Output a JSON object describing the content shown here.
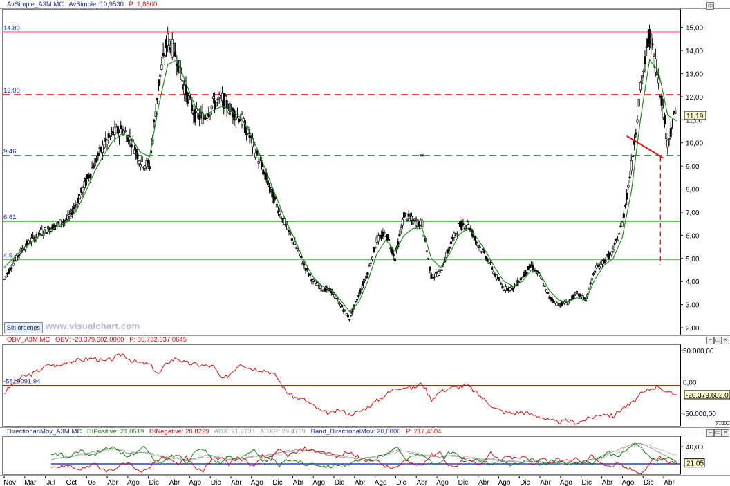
{
  "panels": {
    "price": {
      "legend": [
        {
          "text": "AvSimple_A3M.MC",
          "color": "#1a2faf"
        },
        {
          "text": "AvSimple: 10,9530",
          "color": "#1a2faf"
        },
        {
          "text": "P: 1,8800",
          "color": "#d01010"
        }
      ],
      "badge": "Sin órdenes",
      "watermark": "www.visualchart.com"
    },
    "obv": {
      "legend": [
        {
          "text": "OBV_A3M.MC",
          "color": "#d01010"
        },
        {
          "text": "OBV: -20.379.602,0000",
          "color": "#d01010"
        },
        {
          "text": "P: 85.732.637,0645",
          "color": "#d01010"
        }
      ],
      "scale_box": "x1000"
    },
    "dm": {
      "legend": [
        {
          "text": "DirectionanMov_A3M.MC",
          "color": "#1a2a7a"
        },
        {
          "text": "DIPositive: 21,0519",
          "color": "#178017"
        },
        {
          "text": "DINegative: 20,8229",
          "color": "#d01010"
        },
        {
          "text": "ADX: 21,2738",
          "color": "#9a9a9a"
        },
        {
          "text": "ADXR: 29,4739",
          "color": "#9a9a9a"
        },
        {
          "text": "Band_DirectionalMov: 20,0000",
          "color": "#1a2faf"
        },
        {
          "text": "P: 217,4604",
          "color": "#d01010"
        }
      ]
    }
  },
  "chart_data": [
    {
      "type": "line",
      "title": "",
      "x_tick_labels": [
        "Nov",
        "Mar",
        "Jul",
        "Oct",
        "05",
        "Abr",
        "Ago",
        "Dic",
        "Abr",
        "Ago",
        "Dic",
        "Abr",
        "Ago",
        "Dic",
        "Abr",
        "Ago",
        "Dic",
        "Abr",
        "Ago",
        "Dic",
        "Abr",
        "Ago",
        "Dic",
        "Abr",
        "Ago",
        "Dic",
        "Abr",
        "Ago",
        "Dic",
        "Abr",
        "Ago",
        "Dic",
        "Abr"
      ],
      "y_tick_labels": [
        "15,00",
        "14,00",
        "13,00",
        "12,00",
        "11,00",
        "10,00",
        "9,00",
        "8,00",
        "7,00",
        "6,00",
        "5,00",
        "4,00",
        "3,00",
        "2,00"
      ],
      "ylim": [
        1.7,
        15.8
      ],
      "last_value_label": "11,19",
      "last_value": 11.19,
      "series": [
        {
          "name": "",
          "style": "candles",
          "color": "#000000",
          "values": [
            4.1,
            4.8,
            5.4,
            5.8,
            6.1,
            6.3,
            6.5,
            6.7,
            7.4,
            8.3,
            9.2,
            9.9,
            10.4,
            10.6,
            10.1,
            9.2,
            9.0,
            12.6,
            14.5,
            13.7,
            12.2,
            11.2,
            11.1,
            11.7,
            11.9,
            11.4,
            11.1,
            10.3,
            9.3,
            8.3,
            7.3,
            6.4,
            5.6,
            4.7,
            4.0,
            3.7,
            3.6,
            3.0,
            2.4,
            3.4,
            4.4,
            5.8,
            6.1,
            5.0,
            6.9,
            6.6,
            6.5,
            4.2,
            4.4,
            5.5,
            6.4,
            6.5,
            5.7,
            5.1,
            4.3,
            3.7,
            3.7,
            4.2,
            4.7,
            4.2,
            3.3,
            3.0,
            3.1,
            3.5,
            3.2,
            4.5,
            4.9,
            5.3,
            6.5,
            9.0,
            12.3,
            14.7,
            12.8,
            10.0,
            11.6
          ]
        },
        {
          "name": "AvSimple",
          "style": "line",
          "color": "#1f8f1f",
          "values": [
            4.6,
            5.0,
            5.4,
            5.7,
            6.0,
            6.2,
            6.4,
            6.6,
            7.1,
            7.9,
            8.8,
            9.5,
            10.1,
            10.4,
            10.2,
            9.6,
            9.4,
            11.6,
            13.4,
            13.6,
            12.6,
            11.6,
            11.2,
            11.4,
            11.6,
            11.4,
            11.1,
            10.5,
            9.6,
            8.6,
            7.6,
            6.6,
            5.8,
            4.9,
            4.2,
            3.8,
            3.6,
            3.2,
            2.7,
            3.1,
            4.0,
            5.2,
            5.8,
            5.3,
            6.0,
            6.3,
            6.3,
            5.0,
            4.6,
            5.2,
            6.0,
            6.3,
            5.9,
            5.3,
            4.6,
            4.0,
            3.8,
            4.0,
            4.5,
            4.3,
            3.6,
            3.2,
            3.1,
            3.3,
            3.2,
            4.1,
            4.7,
            5.0,
            5.9,
            7.9,
            11.0,
            13.6,
            13.1,
            11.2,
            10.95
          ]
        }
      ],
      "horizontal_lines": [
        {
          "label": "14.80",
          "value": 14.8,
          "color": "#e01010",
          "style": "solid"
        },
        {
          "label": "12.09",
          "value": 12.09,
          "color": "#e01010",
          "style": "dashed"
        },
        {
          "label": "9.46",
          "value": 9.46,
          "color": "#1f8f3f",
          "style": "dashed"
        },
        {
          "label": "6.61",
          "value": 6.61,
          "color": "#2aa82a",
          "style": "solid"
        },
        {
          "label": "4.9",
          "value": 4.95,
          "color": "#5ecf5e",
          "style": "solid"
        }
      ],
      "annotations": [
        {
          "kind": "trendline",
          "color": "#e01010",
          "from": [
            68.5,
            10.3
          ],
          "to": [
            72.5,
            9.35
          ]
        },
        {
          "kind": "vertical_dashed",
          "color": "#e01010",
          "x": 72.2,
          "y_range": [
            4.7,
            9.4
          ]
        }
      ]
    },
    {
      "type": "line",
      "title": "",
      "y_tick_labels": [
        "50.000,00",
        "0,00",
        "-50.000,00"
      ],
      "ylim": [
        -70000,
        60000
      ],
      "last_value_label": "-20.379.602,0",
      "last_value": -20379.602,
      "series": [
        {
          "name": "OBV",
          "color": "#d01010",
          "values": [
            -18000,
            -2000,
            8000,
            12000,
            20000,
            28000,
            25000,
            33000,
            34000,
            36000,
            38000,
            32000,
            37000,
            45000,
            34000,
            30000,
            28000,
            12000,
            32000,
            38000,
            30000,
            28000,
            26000,
            25000,
            3000,
            15000,
            30000,
            22000,
            20000,
            18000,
            8000,
            -15000,
            -25000,
            -28000,
            -38000,
            -48000,
            -50000,
            -45000,
            -52000,
            -48000,
            -40000,
            -30000,
            -20000,
            -10000,
            -8000,
            -10000,
            -2000,
            -28000,
            -15000,
            -10000,
            -8000,
            -6000,
            -18000,
            -30000,
            -42000,
            -48000,
            -50000,
            -48000,
            -52000,
            -55000,
            -62000,
            -64000,
            -62000,
            -65000,
            -60000,
            -55000,
            -50000,
            -55000,
            -42000,
            -35000,
            -20000,
            -12000,
            -6000,
            -18000,
            -20380
          ]
        }
      ],
      "horizontal_lines": [
        {
          "label": "-5819091,94",
          "value": -5819.09194,
          "color": "#e01010",
          "style": "solid"
        }
      ]
    },
    {
      "type": "line",
      "title": "",
      "y_tick_labels": [
        "40,00"
      ],
      "ylim": [
        8,
        52
      ],
      "last_value_label": "21,05",
      "last_value": 21.05,
      "series": [
        {
          "name": "DIPositive",
          "color": "#178017",
          "values": [
            30,
            32,
            26,
            35,
            33,
            30,
            36,
            40,
            34,
            28,
            34,
            40,
            26,
            20,
            28,
            31,
            22,
            34,
            38,
            26,
            21,
            28,
            25,
            32,
            36,
            22,
            27,
            18,
            25,
            24,
            19,
            21,
            18,
            17,
            20,
            18,
            22,
            25,
            24,
            29,
            35,
            38,
            26,
            31,
            29,
            22,
            19,
            33,
            30,
            22,
            25,
            24,
            19,
            23,
            20,
            19,
            22,
            26,
            18,
            24,
            21,
            21,
            20,
            24,
            19,
            27,
            33,
            28,
            36,
            42,
            38,
            26,
            24,
            27,
            21.05
          ]
        },
        {
          "name": "DINegative",
          "color": "#d01010",
          "values": [
            18,
            16,
            19,
            14,
            15,
            20,
            13,
            12,
            16,
            22,
            14,
            12,
            19,
            28,
            24,
            20,
            29,
            16,
            12,
            25,
            28,
            20,
            27,
            24,
            16,
            29,
            26,
            36,
            30,
            33,
            38,
            35,
            34,
            32,
            28,
            34,
            30,
            22,
            26,
            20,
            15,
            16,
            24,
            19,
            21,
            30,
            34,
            18,
            17,
            27,
            22,
            20,
            32,
            24,
            28,
            26,
            28,
            20,
            27,
            22,
            25,
            23,
            26,
            20,
            30,
            22,
            16,
            20,
            15,
            12,
            10,
            23,
            28,
            22,
            20.82
          ]
        },
        {
          "name": "ADX",
          "color": "#9a9a9a",
          "values": [
            25,
            27,
            28,
            30,
            32,
            34,
            36,
            38,
            36,
            33,
            32,
            34,
            31,
            28,
            27,
            26,
            24,
            26,
            29,
            30,
            27,
            25,
            26,
            27,
            29,
            30,
            31,
            33,
            35,
            37,
            36,
            35,
            32,
            30,
            28,
            27,
            26,
            27,
            28,
            30,
            33,
            36,
            34,
            31,
            30,
            29,
            28,
            30,
            29,
            27,
            26,
            25,
            26,
            24,
            23,
            22,
            22,
            23,
            22,
            21,
            21,
            20,
            21,
            23,
            25,
            28,
            32,
            36,
            40,
            44,
            43,
            38,
            33,
            28,
            21.27
          ]
        },
        {
          "name": "ADXR",
          "color": "#c4c4c4",
          "values": [
            26,
            27,
            28,
            29,
            30,
            32,
            34,
            36,
            37,
            35,
            33,
            33,
            32,
            30,
            28,
            27,
            25,
            25,
            27,
            29,
            28,
            26,
            26,
            26,
            28,
            29,
            30,
            31,
            33,
            35,
            36,
            36,
            34,
            32,
            30,
            28,
            27,
            27,
            27,
            29,
            31,
            34,
            35,
            33,
            31,
            30,
            29,
            29,
            29,
            28,
            27,
            26,
            26,
            25,
            24,
            23,
            22,
            23,
            22,
            22,
            21,
            21,
            21,
            22,
            24,
            26,
            29,
            33,
            37,
            41,
            43,
            41,
            37,
            33,
            29.47
          ]
        }
      ],
      "horizontal_lines": [
        {
          "label": "Band_DirectionalMov",
          "value": 20,
          "color": "#2040e0",
          "style": "solid"
        }
      ]
    }
  ]
}
